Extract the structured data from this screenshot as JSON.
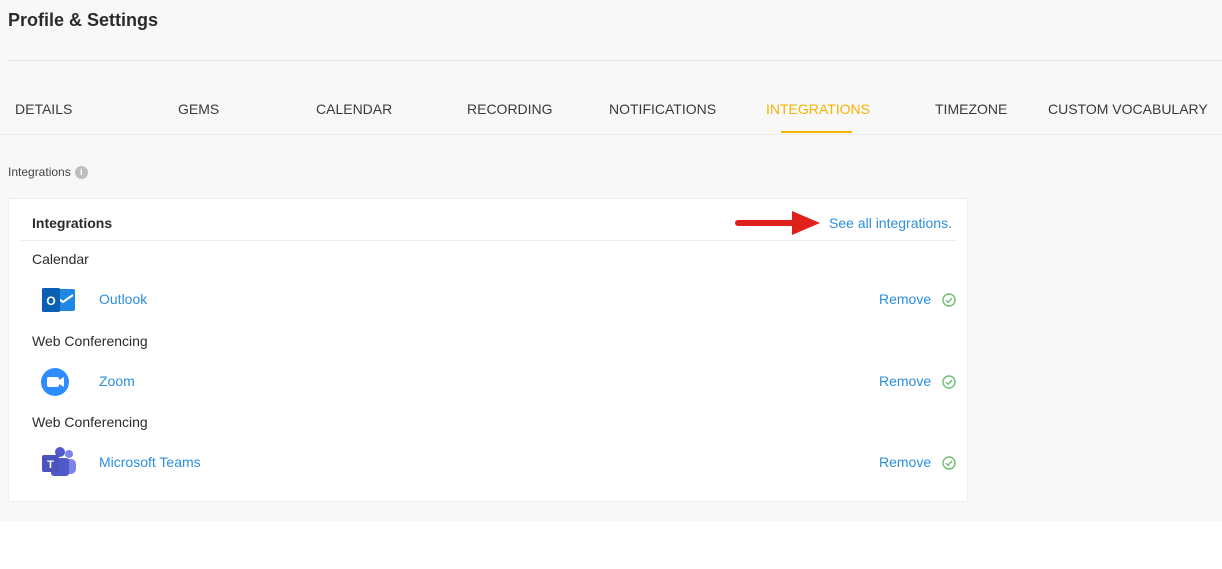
{
  "page": {
    "title": "Profile & Settings"
  },
  "tabs": [
    {
      "label": "DETAILS",
      "active": false
    },
    {
      "label": "GEMS",
      "active": false
    },
    {
      "label": "CALENDAR",
      "active": false
    },
    {
      "label": "RECORDING",
      "active": false
    },
    {
      "label": "NOTIFICATIONS",
      "active": false
    },
    {
      "label": "INTEGRATIONS",
      "active": true
    },
    {
      "label": "TIMEZONE",
      "active": false
    },
    {
      "label": "CUSTOM VOCABULARY",
      "active": false
    }
  ],
  "section": {
    "label": "Integrations",
    "info_icon": "i"
  },
  "card": {
    "title": "Integrations",
    "see_all_link": "See all integrations.",
    "groups": [
      {
        "category": "Calendar",
        "name": "Outlook",
        "icon": "outlook-logo",
        "action": "Remove",
        "status_icon": "check-circle-icon"
      },
      {
        "category": "Web Conferencing",
        "name": "Zoom",
        "icon": "zoom-logo",
        "action": "Remove",
        "status_icon": "check-circle-icon"
      },
      {
        "category": "Web Conferencing",
        "name": "Microsoft Teams",
        "icon": "teams-logo",
        "action": "Remove",
        "status_icon": "check-circle-icon"
      }
    ]
  },
  "colors": {
    "accent": "#f4b400",
    "link": "#2b8fdc",
    "check": "#6cc070",
    "annotation_arrow": "#e0201b"
  }
}
